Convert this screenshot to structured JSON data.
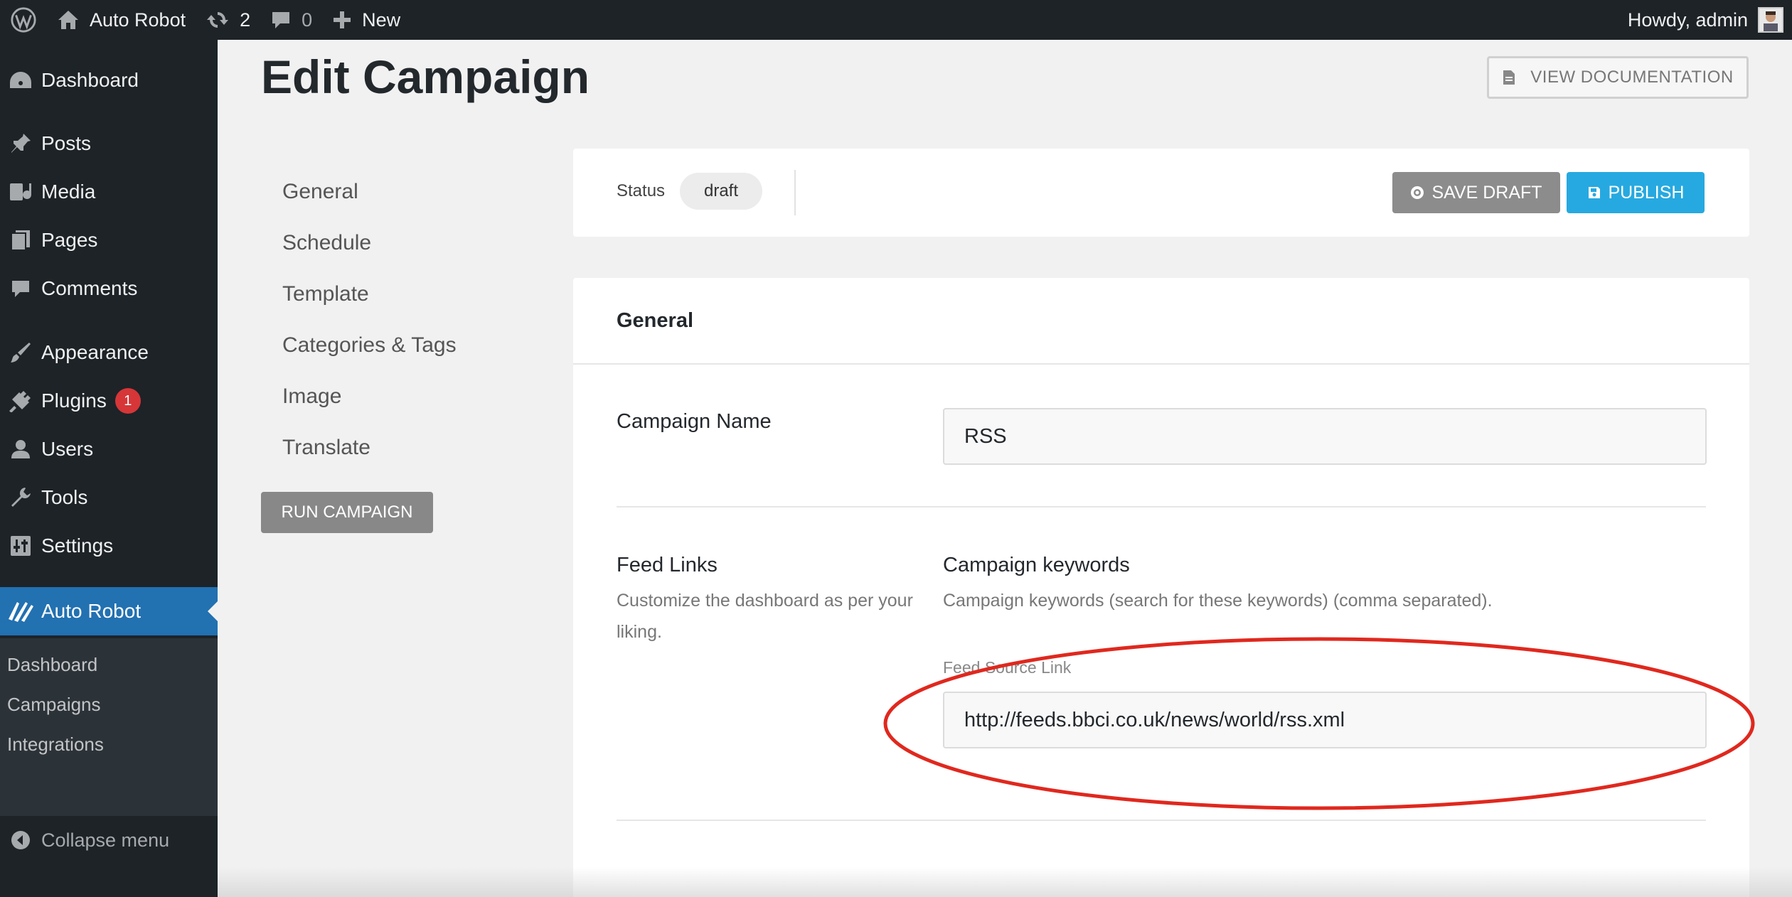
{
  "adminbar": {
    "site_name": "Auto Robot",
    "updates_count": "2",
    "comments_count": "0",
    "new_label": "New",
    "greeting": "Howdy, admin",
    "icons": [
      "wordpress-icon",
      "home-icon",
      "updates-icon",
      "comment-icon",
      "plus-icon",
      "avatar"
    ]
  },
  "sidebar": {
    "items": [
      {
        "label": "Dashboard",
        "icon": "dashboard-icon"
      },
      {
        "label": "Posts",
        "icon": "pin-icon"
      },
      {
        "label": "Media",
        "icon": "media-icon"
      },
      {
        "label": "Pages",
        "icon": "pages-icon"
      },
      {
        "label": "Comments",
        "icon": "comment-icon"
      },
      {
        "label": "Appearance",
        "icon": "brush-icon"
      },
      {
        "label": "Plugins",
        "icon": "plug-icon",
        "badge": "1"
      },
      {
        "label": "Users",
        "icon": "user-icon"
      },
      {
        "label": "Tools",
        "icon": "wrench-icon"
      },
      {
        "label": "Settings",
        "icon": "settings-icon"
      },
      {
        "label": "Auto Robot",
        "icon": "autorobot-icon",
        "current": true
      }
    ],
    "submenu": [
      "Dashboard",
      "Campaigns",
      "Integrations"
    ],
    "collapse_label": "Collapse menu"
  },
  "page": {
    "title": "Edit Campaign",
    "doc_button": "VIEW DOCUMENTATION"
  },
  "tabs": [
    "General",
    "Schedule",
    "Template",
    "Categories & Tags",
    "Image",
    "Translate"
  ],
  "run_button": "RUN CAMPAIGN",
  "status_bar": {
    "label": "Status",
    "value": "draft",
    "save_draft": "SAVE DRAFT",
    "publish": "PUBLISH"
  },
  "general": {
    "title": "General",
    "campaign_name_label": "Campaign Name",
    "campaign_name_value": "RSS",
    "feed_links_label": "Feed Links",
    "feed_links_desc": "Customize the dashboard as per your liking.",
    "keywords_label": "Campaign keywords",
    "keywords_desc": "Campaign keywords (search for these keywords) (comma separated).",
    "feed_source_label": "Feed Source Link",
    "feed_source_value": "http://feeds.bbci.co.uk/news/world/rss.xml"
  },
  "colors": {
    "adminbar_bg": "#1d2327",
    "current_menu": "#2271b1",
    "publish": "#26a9e0",
    "highlight": "#e0281e",
    "badge": "#d63638"
  }
}
